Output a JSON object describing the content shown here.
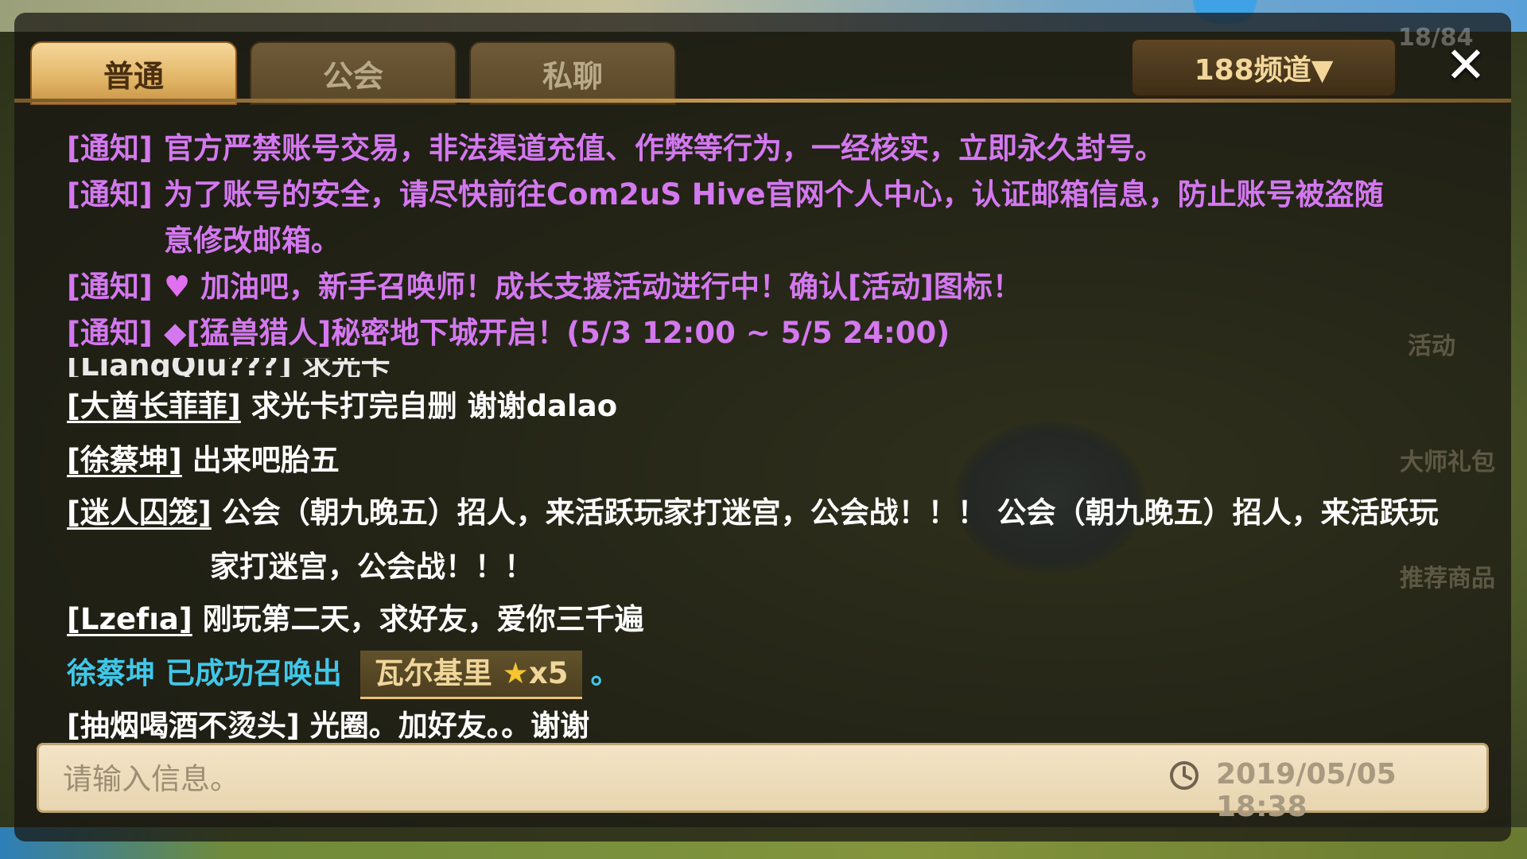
{
  "tabs": [
    {
      "label": "普通",
      "active": true
    },
    {
      "label": "公会",
      "active": false
    },
    {
      "label": "私聊",
      "active": false
    }
  ],
  "channel": {
    "label": "188频道▼"
  },
  "close": {
    "symbol": "✕"
  },
  "background": {
    "corner_text": "18/84",
    "side_menu": [
      "活动",
      "大师礼包",
      "推荐商品"
    ]
  },
  "notices": [
    {
      "tag": "[通知]",
      "text": "官方严禁账号交易，非法渠道充值、作弊等行为，一经核实，立即永久封号。"
    },
    {
      "tag": "[通知]",
      "text": "为了账号的安全，请尽快前往Com2uS Hive官网个人中心，认证邮箱信息，防止账号被盗随",
      "text_cont": "意修改邮箱。"
    },
    {
      "tag": "[通知]",
      "icon": "heart-icon",
      "text": "加油吧，新手召唤师！成长支援活动进行中！确认[活动]图标！"
    },
    {
      "tag": "[通知]",
      "text": "◆[猛兽猎人]秘密地下城开启！(5/3 12:00 ~ 5/5 24:00)"
    }
  ],
  "clipped_line": "[LiangQiu???] 求光卡",
  "chat": [
    {
      "name": "[大酋长菲菲]",
      "text": "求光卡打完自删 谢谢dalao"
    },
    {
      "name": "[徐蔡坤]",
      "text": "出来吧胎五"
    },
    {
      "name": "[迷人囚笼]",
      "text": "公会（朝九晚五）招人，来活跃玩家打迷宫，公会战！！！ 公会（朝九晚五）招人，来活跃玩",
      "text_cont": "家打迷宫，公会战！！！"
    },
    {
      "name": "[Lzefıa]",
      "text": "刚玩第二天，求好友，爱你三千遍"
    }
  ],
  "summon": {
    "player": "徐蔡坤",
    "action": "已成功召唤出",
    "monster": "瓦尔基里",
    "stars": "★",
    "count": "x5",
    "end": "。"
  },
  "last_chat": {
    "name": "[抽烟喝酒不烫头]",
    "text": "光圈。加好友。。谢谢"
  },
  "input": {
    "placeholder": "请输入信息。",
    "timestamp": "2019/05/05  18:38"
  }
}
